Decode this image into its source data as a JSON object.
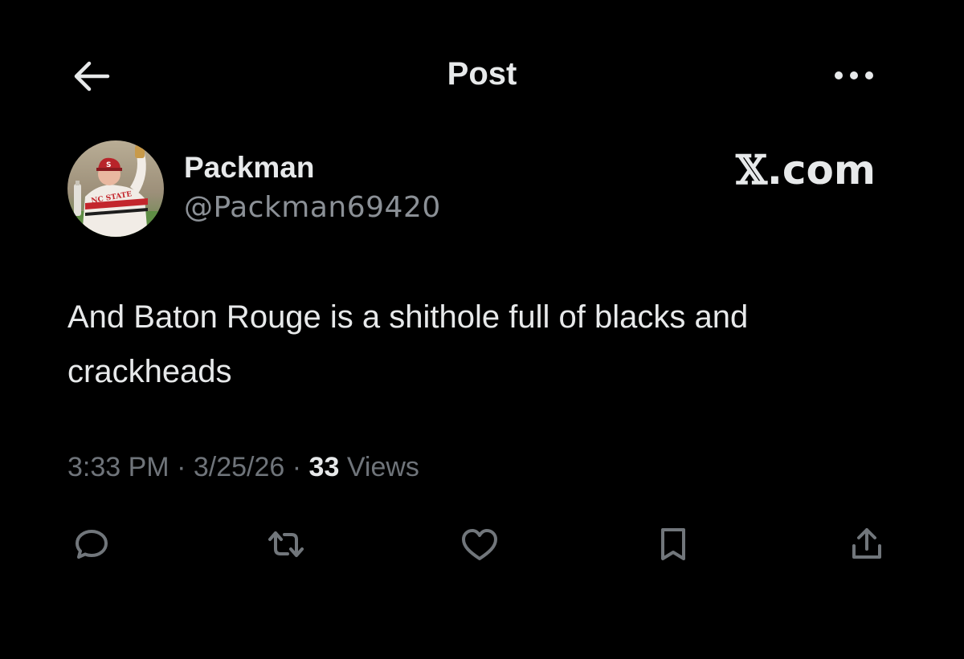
{
  "header": {
    "title": "Post",
    "back_icon": "arrow-left-icon",
    "more_icon": "more-horizontal-icon"
  },
  "post": {
    "author": {
      "display_name": "Packman",
      "handle": "@Packman69420",
      "avatar_icon": "profile-photo-baseball-player",
      "jersey_text": "NC STATE"
    },
    "watermark": {
      "x": "𝕏",
      "domain": ".com"
    },
    "text": "And Baton Rouge is a shithole full of blacks and crackheads",
    "time": "3:33 PM",
    "separator": "·",
    "date": "3/25/26",
    "views_count": "33",
    "views_label": "Views"
  },
  "actions": {
    "reply_icon": "reply-icon",
    "repost_icon": "repost-icon",
    "like_icon": "heart-icon",
    "bookmark_icon": "bookmark-icon",
    "share_icon": "share-icon"
  },
  "colors": {
    "background": "#000000",
    "primary_text": "#e7e9ea",
    "secondary_text": "#6f747a",
    "icon": "#71767b"
  }
}
